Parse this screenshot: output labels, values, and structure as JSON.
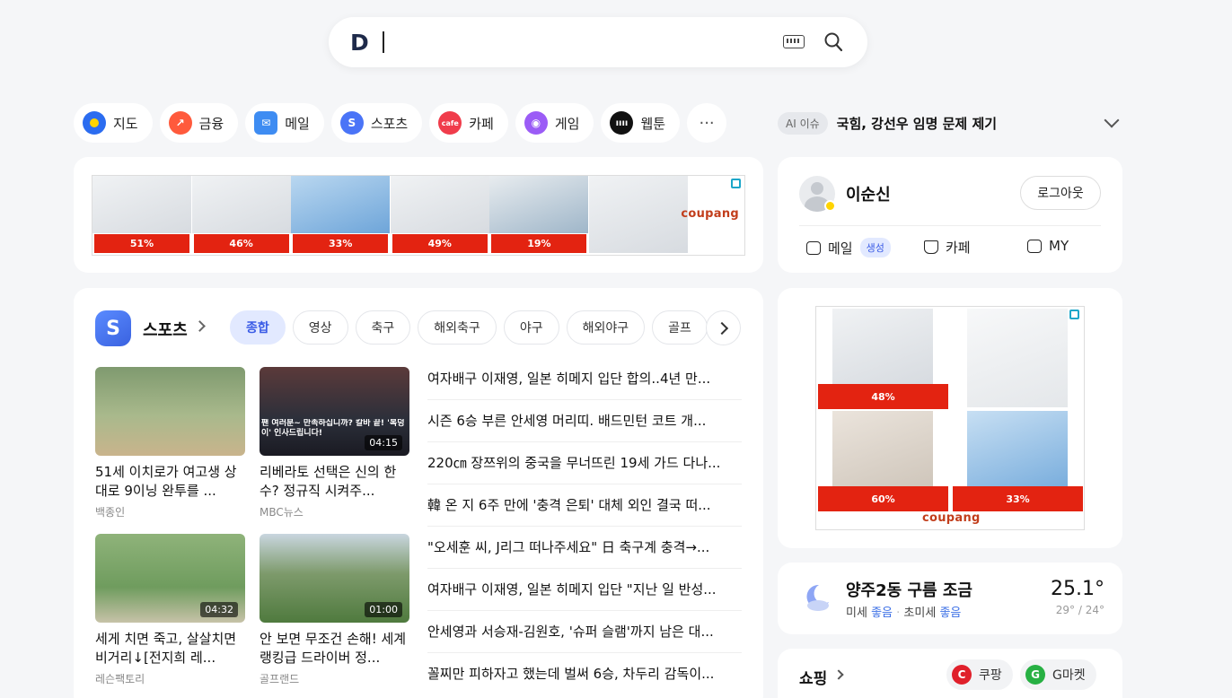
{
  "search": {
    "logo": "D",
    "placeholder": ""
  },
  "shortcuts": [
    {
      "label": "지도",
      "icon": "map-pin-icon",
      "color": "#2b6cf0"
    },
    {
      "label": "금융",
      "icon": "finance-chart-icon",
      "color": "#ff5a3c"
    },
    {
      "label": "메일",
      "icon": "mail-icon",
      "color": "#3e8cf2"
    },
    {
      "label": "스포츠",
      "icon": "sports-icon",
      "color": "#4a74f7"
    },
    {
      "label": "카페",
      "icon": "cafe-icon",
      "color": "#f03c4b"
    },
    {
      "label": "게임",
      "icon": "game-icon",
      "color": "#9b5cf6"
    },
    {
      "label": "웹툰",
      "icon": "webtoon-icon",
      "color": "#111111"
    }
  ],
  "more_label": "···",
  "ai_issue": {
    "badge": "AI 이슈",
    "text": "국힘, 강선우 임명 문제 제기"
  },
  "top_ad": {
    "discounts": [
      "51%",
      "46%",
      "33%",
      "49%",
      "19%"
    ],
    "brand": "coupang"
  },
  "sports": {
    "logo": "S",
    "title": "스포츠",
    "tabs": [
      "종합",
      "영상",
      "축구",
      "해외축구",
      "야구",
      "해외야구",
      "골프"
    ],
    "tiles": [
      {
        "title": "51세 이치로가 여고생 상대로 9이닝 완투를 ...",
        "source": "백종인",
        "duration": ""
      },
      {
        "title": "리베라토 선택은 신의 한 수? 정규직 시켜주...",
        "source": "MBC뉴스",
        "duration": "04:15",
        "overlay": "팬 여러분~ 만족하십니까? 칼바 끝! '복덩이' 인사드립니다!"
      },
      {
        "title": "세게 치면 죽고, 살살치면 비거리↓[전지희 레...",
        "source": "레슨팩토리",
        "duration": "04:32"
      },
      {
        "title": "안 보면 무조건 손해! 세계랭킹급 드라이버 정...",
        "source": "골프랜드",
        "duration": "01:00"
      }
    ],
    "news": [
      "여자배구 이재영, 일본 히메지 입단 합의..4년 만...",
      "시즌 6승 부른 안세영 머리띠. 배드민턴 코트 개...",
      "220㎝ 장쯔위의 중국을 무너뜨린 19세 가드 다나...",
      "韓 온 지 6주 만에 '충격 은퇴' 대체 외인 결국 떠...",
      "\"오세훈 씨, J리그 떠나주세요\" 日 축구계 충격→...",
      "여자배구 이재영, 일본 히메지 입단 \"지난 일 반성...",
      "안세영과 서승재-김원호, '슈퍼 슬램'까지 남은 대...",
      "꼴찌만 피하자고 했는데 벌써 6승, 차두리 감독이..."
    ]
  },
  "profile": {
    "name": "이순신",
    "logout": "로그아웃",
    "links": [
      {
        "label": "메일",
        "badge": "생성",
        "icon": "mail-outline-icon"
      },
      {
        "label": "카페",
        "icon": "cafe-outline-icon"
      },
      {
        "label": "MY",
        "icon": "my-profile-icon"
      }
    ]
  },
  "side_ad": {
    "discounts": [
      "48%",
      "60%",
      "33%"
    ],
    "brand": "coupang"
  },
  "weather": {
    "location": "양주2동 구름 조금",
    "temp": "25.1°",
    "range": "29° / 24°",
    "dust_label": "미세",
    "dust_value": "좋음",
    "sep": "·",
    "fine_dust_label": "초미세",
    "fine_dust_value": "좋음"
  },
  "shopping": {
    "title": "쇼핑",
    "links": [
      {
        "label": "쿠팡",
        "icon": "C",
        "color": "#e0202b"
      },
      {
        "label": "G마켓",
        "icon": "G",
        "color": "#27b043"
      }
    ]
  }
}
